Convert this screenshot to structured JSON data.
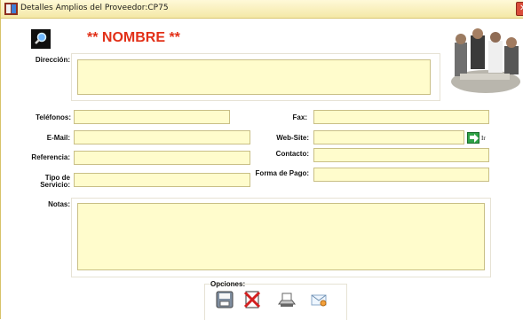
{
  "window": {
    "title": "Detalles Amplios del Proveedor:CP75",
    "close_glyph": "✕"
  },
  "header": {
    "nombre": "** NOMBRE **",
    "search_icon": "magnifier-icon",
    "photo": "people-meeting-photo"
  },
  "form": {
    "direccion_label": "Dirección:",
    "direccion_value": "",
    "telefonos_label": "Teléfonos:",
    "telefonos_value": "",
    "email_label": "E-Mail:",
    "email_value": "",
    "referencia_label": "Referencia:",
    "referencia_value": "",
    "tipo_servicio_label_1": "Tipo de",
    "tipo_servicio_label_2": "Servicio:",
    "tipo_servicio_value": "",
    "fax_label": "Fax:",
    "fax_value": "",
    "website_label": "Web-Site:",
    "website_value": "",
    "ir_label": "Ir",
    "contacto_label": "Contacto:",
    "contacto_value": "",
    "forma_pago_label": "Forma de Pago:",
    "forma_pago_value": "",
    "notas_label": "Notas:",
    "notas_value": ""
  },
  "opciones": {
    "title": "Opciones:",
    "buttons": [
      "save-icon",
      "delete-icon",
      "print-icon",
      "email-icon"
    ]
  },
  "colors": {
    "field_bg": "#fffccc",
    "title_bar": "#f4e8a6",
    "accent_red": "#e23018"
  }
}
